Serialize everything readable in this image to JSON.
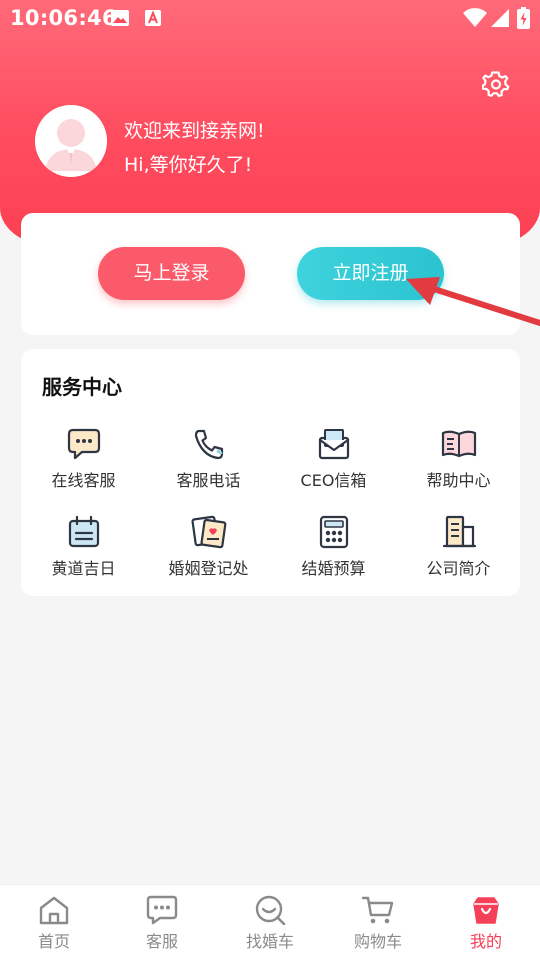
{
  "status_bar": {
    "time": "10:06:46"
  },
  "profile": {
    "welcome_line1": "欢迎来到接亲网!",
    "welcome_line2": "Hi,等你好久了!"
  },
  "auth": {
    "login_label": "马上登录",
    "register_label": "立即注册"
  },
  "services": {
    "title": "服务中心",
    "items": [
      {
        "label": "在线客服",
        "icon": "chat-icon"
      },
      {
        "label": "客服电话",
        "icon": "phone-icon"
      },
      {
        "label": "CEO信箱",
        "icon": "mail-icon"
      },
      {
        "label": "帮助中心",
        "icon": "book-icon"
      },
      {
        "label": "黄道吉日",
        "icon": "calendar-icon"
      },
      {
        "label": "婚姻登记处",
        "icon": "certificate-icon"
      },
      {
        "label": "结婚预算",
        "icon": "calculator-icon"
      },
      {
        "label": "公司简介",
        "icon": "building-icon"
      }
    ]
  },
  "bottom_nav": {
    "items": [
      {
        "label": "首页",
        "icon": "home-icon"
      },
      {
        "label": "客服",
        "icon": "message-icon"
      },
      {
        "label": "找婚车",
        "icon": "search-car-icon"
      },
      {
        "label": "购物车",
        "icon": "cart-icon"
      },
      {
        "label": "我的",
        "icon": "profile-bag-icon",
        "active": true
      }
    ]
  },
  "colors": {
    "brand_red": "#fb5a6a",
    "register_teal": "#2bc3d0",
    "active_nav": "#f5405a"
  }
}
